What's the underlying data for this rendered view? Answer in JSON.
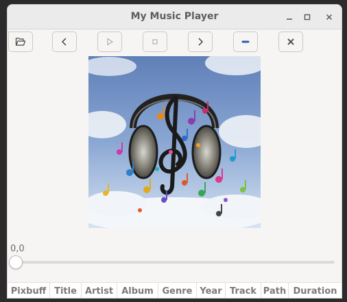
{
  "window": {
    "title": "My Music Player"
  },
  "toolbar": {
    "buttons": [
      {
        "name": "open-button",
        "icon": "folder-open-icon"
      },
      {
        "name": "previous-button",
        "icon": "chevron-left-icon"
      },
      {
        "name": "play-button",
        "icon": "play-icon"
      },
      {
        "name": "stop-button",
        "icon": "stop-icon"
      },
      {
        "name": "next-button",
        "icon": "chevron-right-icon"
      },
      {
        "name": "remove-button",
        "icon": "minus-icon"
      },
      {
        "name": "close-track-button",
        "icon": "x-icon"
      }
    ]
  },
  "player": {
    "position_label": "0,0",
    "progress_fraction": 0
  },
  "playlist": {
    "columns": [
      "Pixbuff",
      "Title",
      "Artist",
      "Album",
      "Genre",
      "Year",
      "Track",
      "Path",
      "Duration"
    ]
  },
  "colors": {
    "accent": "#3584e4",
    "window_bg": "#f6f5f4",
    "title_text": "#5e5e5e"
  }
}
